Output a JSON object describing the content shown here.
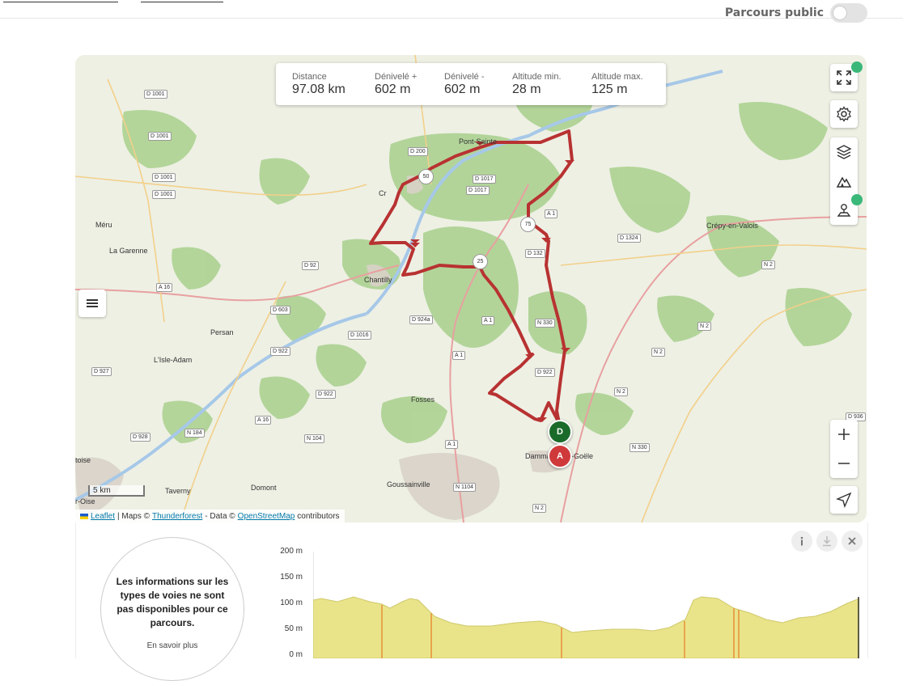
{
  "header": {
    "public_label": "Parcours public"
  },
  "stats": [
    {
      "label": "Distance",
      "value": "97.08 km"
    },
    {
      "label": "Dénivelé +",
      "value": "602 m"
    },
    {
      "label": "Dénivelé -",
      "value": "602 m"
    },
    {
      "label": "Altitude min.",
      "value": "28 m"
    },
    {
      "label": "Altitude max.",
      "value": "125 m"
    }
  ],
  "map": {
    "places": [
      "Pont-Sainte",
      "Cr",
      "Méru",
      "La Garenne",
      "Chantilly",
      "Persan",
      "L'Isle-Adam",
      "Fosses",
      "Dammartin-en-Goële",
      "Crépy-en-Valois",
      "Taverny",
      "Domont",
      "Goussainville",
      "r-Oise",
      "toise"
    ],
    "roads": [
      "D 1001",
      "D 1001",
      "D 1001",
      "D 1001",
      "D 200",
      "D 1017",
      "D 1017",
      "A 1",
      "D 1324",
      "D 132",
      "N 2",
      "D 92",
      "A 16",
      "D 603",
      "D 1016",
      "N 330",
      "D 924a",
      "A 1",
      "D 922",
      "D 927",
      "D 922",
      "A 1",
      "D 922",
      "N 2",
      "N 2",
      "N 2",
      "D 936",
      "A 16",
      "N 184",
      "D 928",
      "N 104",
      "A 1",
      "N 1104",
      "N 330",
      "N 2"
    ],
    "km_markers": [
      "50",
      "75",
      "25"
    ],
    "start_label": "D",
    "end_label": "A",
    "start_color": "#1a6b2a",
    "end_color": "#d0393a",
    "route_color": "#b83232",
    "scale_text": "5 km",
    "attribution": {
      "leaflet": "Leaflet",
      "maps": "| Maps ©",
      "thunderforest": "Thunderforest",
      "data": "- Data ©",
      "osm": "OpenStreetMap",
      "contributors": "contributors"
    },
    "controls": [
      "fullscreen-icon",
      "settings-icon",
      "layers-icon",
      "elevation-icon",
      "poi-icon",
      "zoom-in-icon",
      "zoom-out-icon",
      "locate-icon",
      "menu-icon"
    ]
  },
  "surface_info": {
    "message": "Les informations sur les types de voies ne sont pas disponibles pour ce parcours.",
    "link": "En savoir plus"
  },
  "elevation_profile": {
    "y_ticks": [
      "200 m",
      "150 m",
      "100 m",
      "50 m",
      "0 m"
    ],
    "fill_color": "#e9e48a",
    "highlight_color": "#e8a44c"
  }
}
